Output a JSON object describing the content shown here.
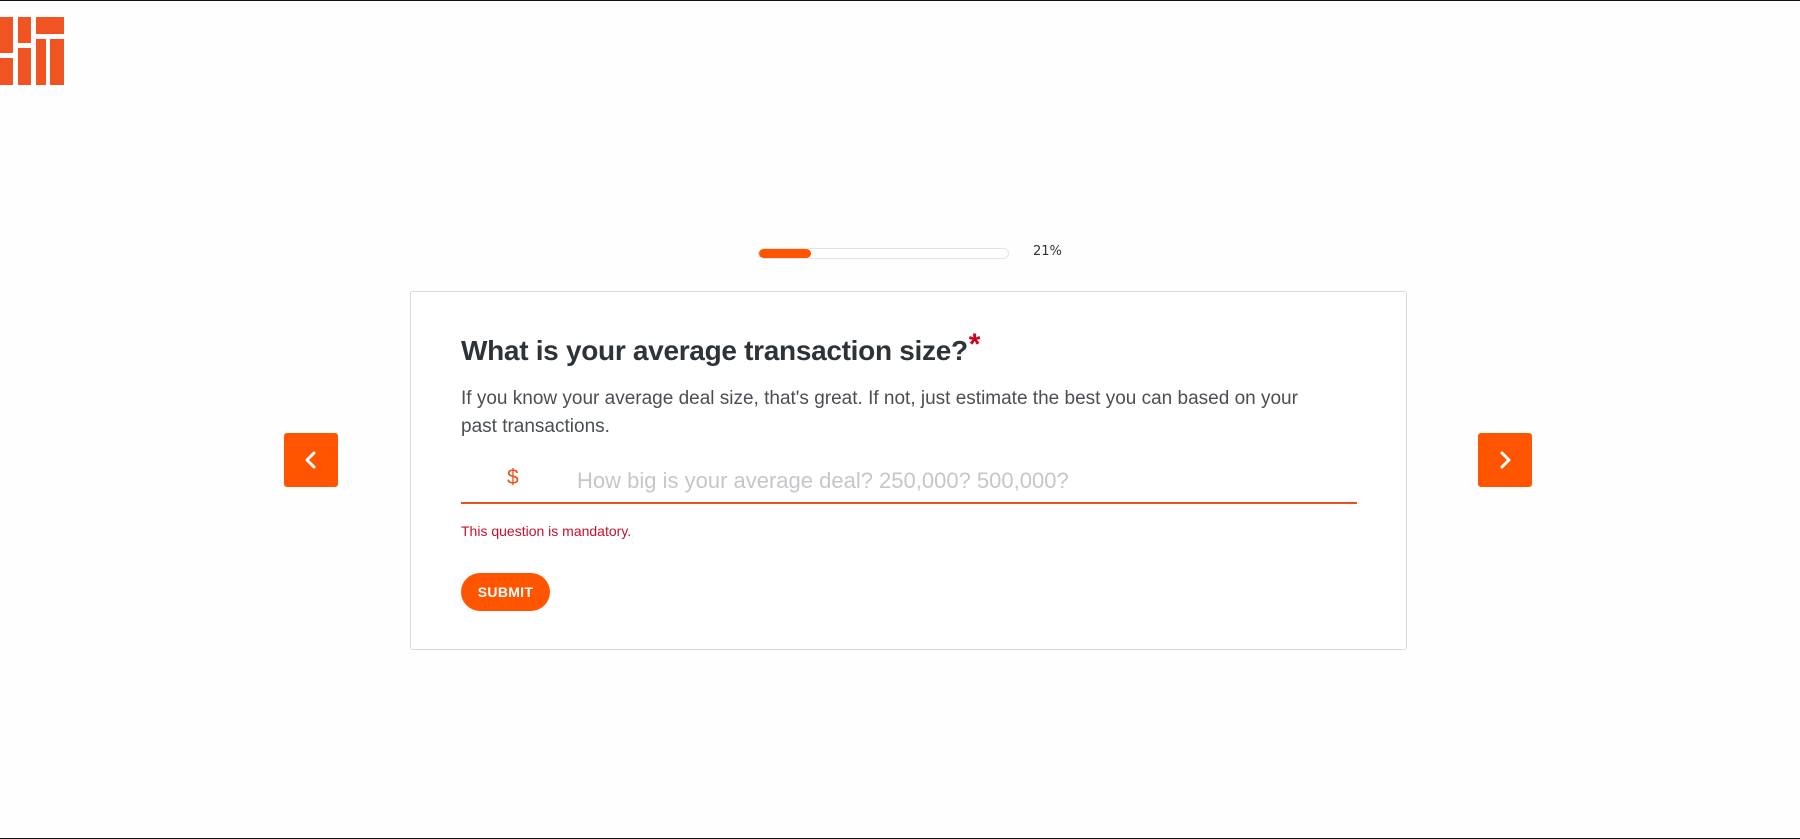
{
  "brand": {
    "logo_icon": "brick-logo-icon",
    "accent_color": "#ff5500",
    "logo_color": "#f05423",
    "error_color": "#c8102e"
  },
  "progress": {
    "percent": 21,
    "label": "21%"
  },
  "navigation": {
    "prev_icon": "chevron-left-icon",
    "next_icon": "chevron-right-icon"
  },
  "question": {
    "title": "What is your average transaction size?",
    "required_marker": "*",
    "help_text": "If you know your average deal size, that's great. If not, just estimate the best you can based on your past transactions.",
    "currency_symbol": "$",
    "input_value": "",
    "input_placeholder": "How big is your average deal? 250,000? 500,000?",
    "error_message": "This question is mandatory.",
    "submit_label": "SUBMIT"
  }
}
